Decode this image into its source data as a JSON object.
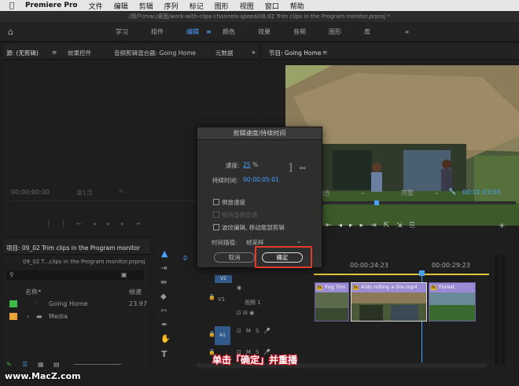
{
  "menubar": {
    "apple": "",
    "app_name": "Premiere Pro",
    "items": [
      "文件",
      "编辑",
      "剪辑",
      "序列",
      "标记",
      "图形",
      "视图",
      "窗口",
      "帮助"
    ]
  },
  "title_path": "/用户/mac/桌面/work-with-clips-channels-speed/08.02 Trim clips in the Program monitor.prproj *",
  "workspaces": {
    "items": [
      "学习",
      "组件",
      "编辑",
      "颜色",
      "效果",
      "音频",
      "图形",
      "库"
    ],
    "active": "编辑",
    "more": "»"
  },
  "source_panel": {
    "tabs": [
      "源: (无剪辑)",
      "效果控件",
      "音频剪辑混合器: Going Home",
      "元数据"
    ],
    "timecode": "00;00;00;00",
    "page": "第1页"
  },
  "program_panel": {
    "title": "节目: Going Home",
    "fit": "适合",
    "quality": "完整",
    "timecode": "00:01:03:03"
  },
  "dialog": {
    "title": "剪辑速度/持续时间",
    "speed_label": "速度:",
    "speed_value": "25",
    "speed_unit": "%",
    "duration_label": "持续时间:",
    "duration_value": "00:00:05:01",
    "reverse_label": "倒放速度",
    "pitch_label": "保持音频音调",
    "ripple_label": "波纹编辑, 移动尾部剪辑",
    "interp_label": "时间插值:",
    "interp_value": "帧采样",
    "cancel": "取消",
    "ok": "确定"
  },
  "project_panel": {
    "title": "项目: 09_02 Trim clips in the Program monitor",
    "file": "09_02 T...clips in the Program monitor.prproj",
    "col_name": "名称",
    "col_rate": "帧速",
    "items": [
      {
        "name": "Going Home",
        "rate": "23.97",
        "color": "#3fb94a"
      },
      {
        "name": "Media",
        "rate": "",
        "color": "#e8a33a"
      }
    ]
  },
  "timeline": {
    "timecodes": [
      "00:00:24:23",
      "00:00:29:23"
    ],
    "tracks": {
      "v2": "V2",
      "v1": "V1",
      "v1_name": "视频 1",
      "a1": "A1"
    },
    "clips": [
      "Fog Tim",
      "Kids rolling a tire.mp4",
      "Forest"
    ]
  },
  "caption": "单击「确定」并重播",
  "watermark": "www.MacZ.com",
  "colors": {
    "accent": "#4aa0ff",
    "highlight": "#e23b2c",
    "clip": "#9b8bd4"
  }
}
